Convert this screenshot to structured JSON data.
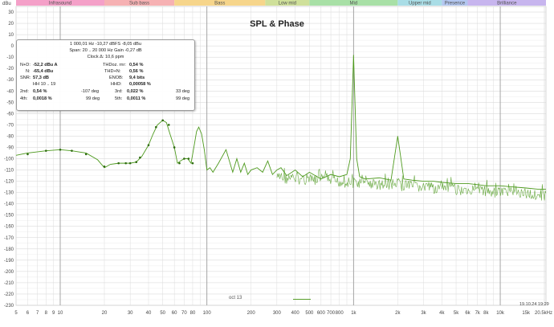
{
  "title": "SPL & Phase",
  "y_unit_label": "dBu",
  "bands": [
    {
      "label": "Infrasound",
      "from": 5,
      "to": 20,
      "color": "#f4a0c8"
    },
    {
      "label": "Sub bass",
      "from": 20,
      "to": 60,
      "color": "#f6b1b3"
    },
    {
      "label": "Bass",
      "from": 60,
      "to": 250,
      "color": "#f6d58b"
    },
    {
      "label": "Low mid",
      "from": 250,
      "to": 500,
      "color": "#cfe09a"
    },
    {
      "label": "Mid",
      "from": 500,
      "to": 2000,
      "color": "#a8e0a6"
    },
    {
      "label": "Upper mid",
      "from": 2000,
      "to": 4000,
      "color": "#a9dde6"
    },
    {
      "label": "Presence",
      "from": 4000,
      "to": 6000,
      "color": "#b3c7f0"
    },
    {
      "label": "Brilliance",
      "from": 6000,
      "to": 20500,
      "color": "#c7b5ee"
    }
  ],
  "x_tick_labels": [
    "5",
    "6",
    "7",
    "8",
    "9",
    "10",
    "20",
    "30",
    "40",
    "50",
    "60",
    "70",
    "80",
    "100",
    "200",
    "300",
    "400",
    "500",
    "600",
    "700",
    "800",
    "1k",
    "2k",
    "3k",
    "4k",
    "5k",
    "6k",
    "7k",
    "8k",
    "10k",
    "15k",
    "20.5kHz"
  ],
  "x_tick_values": [
    5,
    6,
    7,
    8,
    9,
    10,
    20,
    30,
    40,
    50,
    60,
    70,
    80,
    100,
    200,
    300,
    400,
    500,
    600,
    700,
    800,
    1000,
    2000,
    3000,
    4000,
    5000,
    6000,
    7000,
    8000,
    10000,
    15000,
    20500
  ],
  "y_ticks": [
    30,
    20,
    10,
    0,
    -10,
    -20,
    -30,
    -40,
    -50,
    -60,
    -70,
    -80,
    -90,
    -100,
    -110,
    -120,
    -130,
    -140,
    -150,
    -160,
    -170,
    -180,
    -190,
    -200,
    -210,
    -220,
    -230
  ],
  "info": {
    "line1": "1 000,01 Hz  -10,27 dBFS  -8,05 dBu",
    "line2": "Span: 20 .. 20 000 Hz   Gain -0,27 dB",
    "line3": "Clock Δ: 10,6 ppm",
    "nd_label": "N+D:",
    "nd_value": "-52,2 dBu A",
    "thd_label": "THDoz. rnr:",
    "thd_value": "0,54 %",
    "n_label": "N:",
    "n_value": "-65,4 dBu",
    "thdn_label": "THD+N:",
    "thdn_value": "0,56 %",
    "snr_label": "SNR:",
    "snr_value": "57,3 dB",
    "enob_label": "ENOB:",
    "enob_value": "9,4 bits",
    "hh_label": "HH 10 .. 19",
    "hhd_label": "HHD:",
    "hhd_value": "0,00058 %",
    "h2_label": "2nd:",
    "h2_value": "0,54 %",
    "h2_phase": "-107 deg",
    "h3_label": "3rd:",
    "h3_value": "0,022 %",
    "h3_phase": "33 deg",
    "h4_label": "4th:",
    "h4_value": "0,0018 %",
    "h4_phase": "99 deg",
    "h5_label": "5th:",
    "h5_value": "0,0011 %",
    "h5_phase": "99 deg"
  },
  "legend_label": "oct 13",
  "timestamp": "19.10.24 19:29",
  "colors": {
    "trace": "#4e9a1e",
    "grid": "#dcdcdc",
    "grid_major": "#9c9c9c"
  },
  "chart_data": {
    "type": "line",
    "title": "SPL & Phase",
    "x_scale": "log",
    "xlim": [
      5,
      20500
    ],
    "ylim": [
      -230,
      35
    ],
    "grid": true,
    "series": [
      {
        "name": "oct 13",
        "x": [
          5,
          6,
          8,
          10,
          12,
          15,
          18,
          20,
          22,
          25,
          28,
          30,
          33,
          36,
          40,
          43,
          46,
          50,
          53,
          56,
          60,
          63,
          66,
          70,
          74,
          78,
          82,
          85,
          88,
          92,
          96,
          100,
          105,
          110,
          120,
          135,
          150,
          160,
          170,
          180,
          190,
          200,
          220,
          240,
          260,
          280,
          300,
          320,
          350,
          380,
          400,
          450,
          500,
          600,
          700,
          800,
          900,
          950,
          1000,
          1050,
          1100,
          1200,
          1500,
          1800,
          2000,
          2200,
          2500,
          3000,
          3500,
          4000,
          5000,
          6000,
          7000,
          8000,
          10000,
          12000,
          15000,
          18000,
          20500
        ],
        "y": [
          -97,
          -95,
          -93,
          -92,
          -93,
          -95,
          -101,
          -108,
          -105,
          -104,
          -104,
          -104,
          -103,
          -98,
          -88,
          -78,
          -70,
          -66,
          -68,
          -78,
          -90,
          -104,
          -102,
          -100,
          -100,
          -104,
          -88,
          -76,
          -72,
          -78,
          -92,
          -110,
          -108,
          -112,
          -104,
          -92,
          -112,
          -100,
          -112,
          -104,
          -114,
          -110,
          -108,
          -112,
          -102,
          -114,
          -110,
          -108,
          -115,
          -112,
          -110,
          -116,
          -112,
          -118,
          -114,
          -116,
          -114,
          -100,
          -8,
          -100,
          -116,
          -118,
          -117,
          -119,
          -80,
          -118,
          -119,
          -120,
          -120,
          -121,
          -122,
          -122,
          -123,
          -124,
          -124,
          -125,
          -126,
          -127,
          -127
        ]
      }
    ],
    "series_markers": [
      {
        "name": "oct 13 dots",
        "x": [
          6,
          8,
          10,
          12,
          15,
          20,
          25,
          28,
          30,
          33,
          35,
          40,
          45,
          50,
          55,
          60,
          65,
          70,
          75,
          80
        ],
        "y": [
          -96,
          -93,
          -92,
          -93,
          -96,
          -107,
          -104,
          -104,
          -104,
          -103,
          -99,
          -88,
          -72,
          -66,
          -70,
          -90,
          -104,
          -100,
          -100,
          -104
        ]
      }
    ]
  }
}
